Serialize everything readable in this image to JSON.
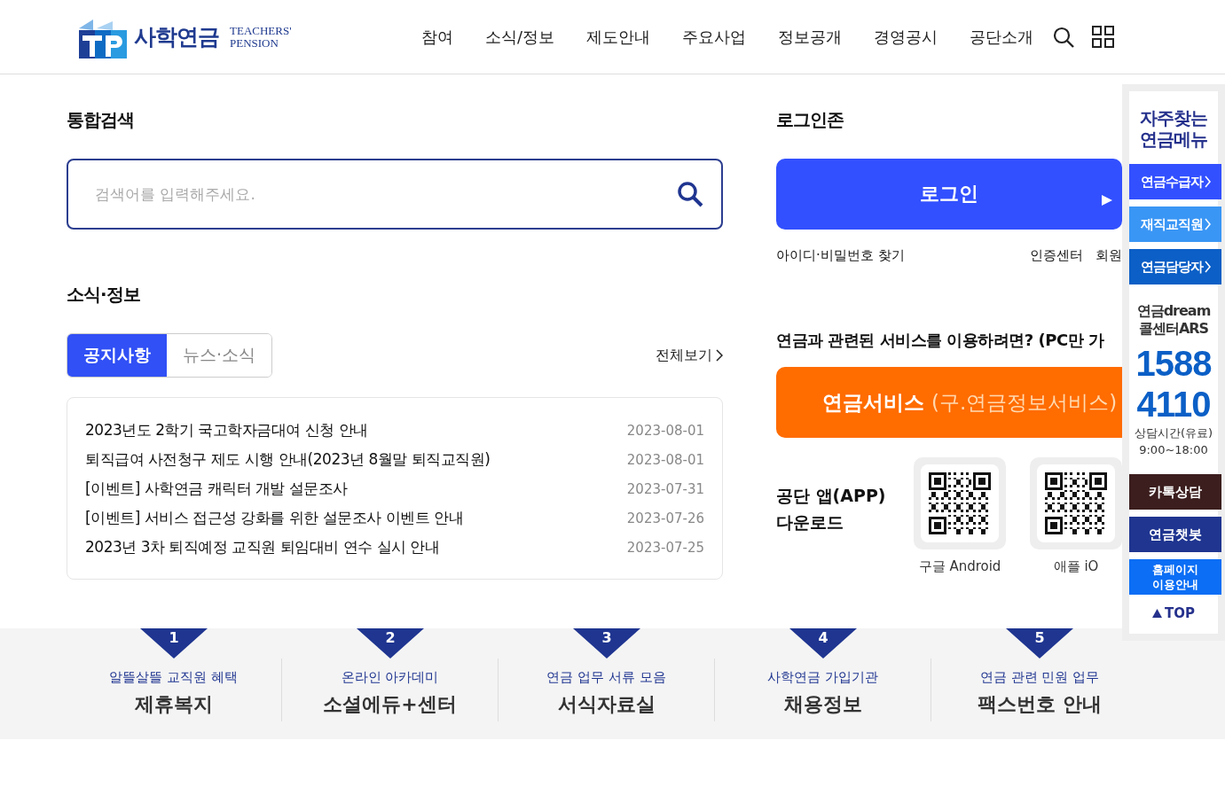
{
  "header": {
    "logo_korean": "사학연금",
    "logo_english_1": "TEACHERS'",
    "logo_english_2": "PENSION",
    "nav": [
      "참여",
      "소식/정보",
      "제도안내",
      "주요사업",
      "정보공개",
      "경영공시",
      "공단소개"
    ]
  },
  "search": {
    "title": "통합검색",
    "placeholder": "검색어를 입력해주세요."
  },
  "news": {
    "title": "소식·정보",
    "more": "전체보기",
    "tabs": [
      {
        "label": "공지사항",
        "selected": true
      },
      {
        "label": "뉴스·소식",
        "selected": false
      }
    ],
    "items": [
      {
        "title": "2023년도 2학기 국고학자금대여 신청 안내",
        "date": "2023-08-01"
      },
      {
        "title": "퇴직급여 사전청구 제도 시행 안내(2023년 8월말 퇴직교직원)",
        "date": "2023-08-01"
      },
      {
        "title": "[이벤트] 사학연금 캐릭터 개발 설문조사",
        "date": "2023-07-31"
      },
      {
        "title": "[이벤트] 서비스 접근성 강화를 위한 설문조사 이벤트 안내",
        "date": "2023-07-26"
      },
      {
        "title": "2023년 3차 퇴직예정 교직원 퇴임대비 연수 실시 안내",
        "date": "2023-07-25"
      }
    ]
  },
  "login": {
    "title": "로그인존",
    "button": "로그인",
    "find": "아이디·비밀번호 찾기",
    "links": [
      "인증센터",
      "회원"
    ]
  },
  "service": {
    "question": "연금과 관련된 서비스를 이용하려면? (PC만 가",
    "button_main": "연금서비스",
    "button_sub": "(구.연금정보서비스)"
  },
  "app": {
    "title_1": "공단 앱(APP)",
    "title_2": "다운로드",
    "stores": [
      {
        "label": "구글 Android"
      },
      {
        "label": "애플 iO"
      }
    ]
  },
  "quick_menu": {
    "title_1": "자주찾는",
    "title_2": "연금메뉴",
    "links": [
      {
        "label": "연금수급자",
        "color": "#3250ff"
      },
      {
        "label": "재직교직원",
        "color": "#3a96f5"
      },
      {
        "label": "연금담당자",
        "color": "#0b5fc6"
      }
    ],
    "ars_1": "연금dream",
    "ars_2": "콜센터ARS",
    "phone_1": "1588",
    "phone_2": "4110",
    "hours_1": "상담시간(유료)",
    "hours_2": "9:00~18:00",
    "buttons": [
      {
        "label": "카톡상담",
        "color": "#3c1e1e"
      },
      {
        "label": "연금챗봇",
        "color": "#1f3590"
      },
      {
        "label": "홈페이지\n이용안내",
        "color": "#0b6ef5"
      }
    ],
    "top": "TOP"
  },
  "features": [
    {
      "number": "1",
      "subtitle": "알뜰살뜰 교직원 혜택",
      "title": "제휴복지"
    },
    {
      "number": "2",
      "subtitle": "온라인 아카데미",
      "title": "소셜에듀+센터"
    },
    {
      "number": "3",
      "subtitle": "연금 업무 서류 모음",
      "title": "서식자료실"
    },
    {
      "number": "4",
      "subtitle": "사학연금 가입기관",
      "title": "채용정보"
    },
    {
      "number": "5",
      "subtitle": "연금 관련 민원 업무",
      "title": "팩스번호 안내"
    }
  ]
}
